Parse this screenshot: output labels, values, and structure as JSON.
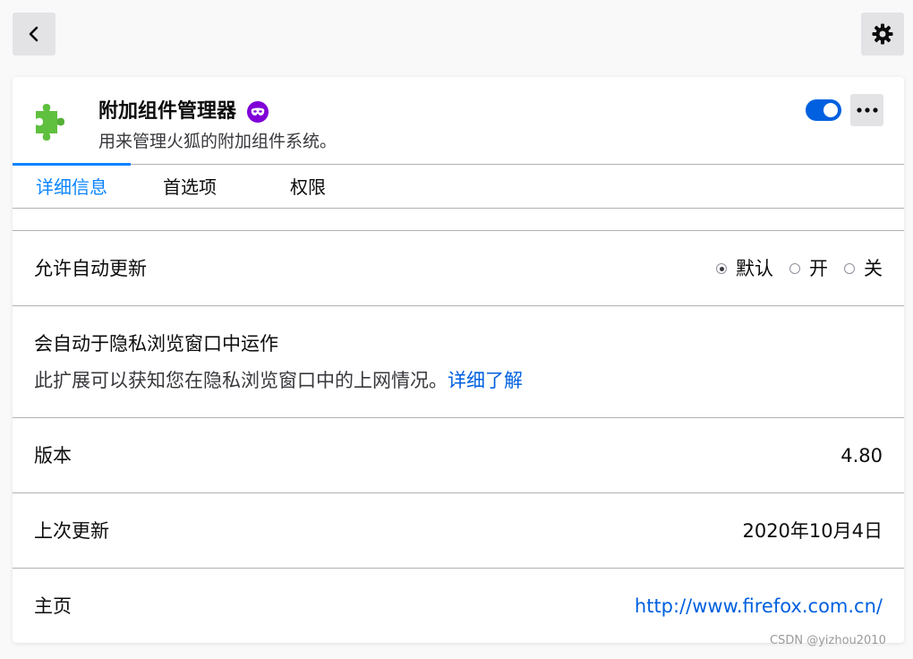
{
  "topbar": {
    "back_icon": "chevron-left-icon",
    "settings_icon": "gear-icon"
  },
  "extension": {
    "name": "附加组件管理器",
    "description": "用来管理火狐的附加组件系统。",
    "icon": "puzzle-piece-icon",
    "icon_color": "#5fbf3f",
    "private_badge_color": "#8000d7",
    "enabled": true,
    "toggle_color": "#0060df"
  },
  "tabs": [
    {
      "label": "详细信息",
      "active": true
    },
    {
      "label": "首选项",
      "active": false
    },
    {
      "label": "权限",
      "active": false
    }
  ],
  "auto_update": {
    "label": "允许自动更新",
    "options": [
      {
        "label": "默认",
        "checked": true
      },
      {
        "label": "开",
        "checked": false
      },
      {
        "label": "关",
        "checked": false
      }
    ]
  },
  "private_browsing": {
    "label": "会自动于隐私浏览窗口中运作",
    "description": "此扩展可以获知您在隐私浏览窗口中的上网情况。",
    "learn_more": "详细了解"
  },
  "version": {
    "label": "版本",
    "value": "4.80"
  },
  "last_updated": {
    "label": "上次更新",
    "value": "2020年10月4日"
  },
  "homepage": {
    "label": "主页",
    "url": "http://www.firefox.com.cn/"
  },
  "watermark": "CSDN @yizhou2010",
  "accent_color": "#0a84ff",
  "link_color": "#0060df"
}
